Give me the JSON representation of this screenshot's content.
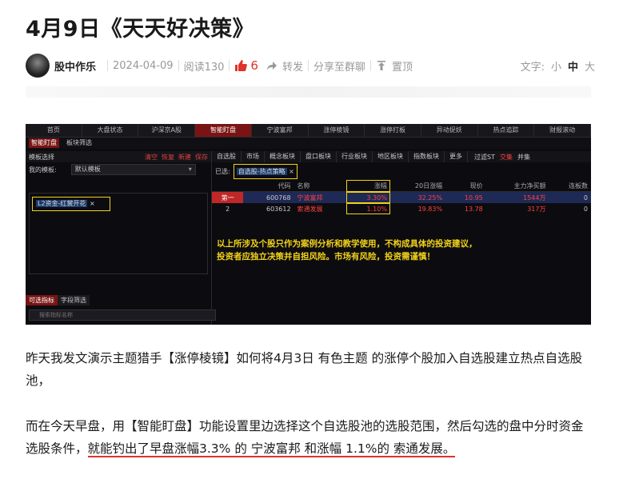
{
  "article": {
    "title": "4月9日《天天好决策》",
    "author": "股中作乐",
    "date": "2024-04-09",
    "reads": "阅读130",
    "likes": "6",
    "share_label": "转发",
    "share_group_label": "分享至群聊",
    "pin_label": "置顶",
    "font_label": "文字:",
    "font_sizes": [
      "小",
      "中",
      "大"
    ]
  },
  "screenshot": {
    "top_tabs": [
      "首页",
      "大盘状态",
      "沪深京A股",
      "智能盯盘",
      "宁波富邦",
      "涨停棱镜",
      "涨停打板",
      "异动捉妖",
      "热点追踪",
      "财报滚动"
    ],
    "active_tab": "智能盯盘",
    "sub_tabs": [
      "智能盯盘",
      "板块筛选"
    ],
    "left_header": "模板选择",
    "left_actions": [
      "清空",
      "恢复",
      "新建",
      "保存"
    ],
    "my_template_label": "我的模板:",
    "my_template_value": "默认模板",
    "template_tag": "L2资金-红裳开花",
    "bottom_tabs": [
      "可选指标",
      "字段筛选"
    ],
    "search_placeholder": "搜索指标名称",
    "filter_tabs": [
      "自选股",
      "市场",
      "概念板块",
      "盘口板块",
      "行业板块",
      "地区板块",
      "指数板块",
      "更多"
    ],
    "filter_st": "过滤ST",
    "radio_options": [
      "交集",
      "并集"
    ],
    "selected_label": "已选:",
    "selected_chip": "自选股-热点策略",
    "table_headers": [
      "代码",
      "名称",
      "涨幅",
      "20日涨幅",
      "现价",
      "主力净买额",
      "连板数"
    ],
    "rows": [
      {
        "rank": "第一",
        "code": "600768",
        "name": "宁波富邦",
        "chg": "3.30%",
        "chg20": "32.25%",
        "price": "10.95",
        "net": "1544万",
        "boards": "0"
      },
      {
        "rank": "2",
        "code": "603612",
        "name": "索通发展",
        "chg": "1.10%",
        "chg20": "19.83%",
        "price": "13.78",
        "net": "317万",
        "boards": "0"
      }
    ],
    "notice_line1": "以上所涉及个股只作为案例分析和教学使用，不构成具体的投资建议，",
    "notice_line2": "投资者应独立决策并自担风险。市场有风险，投资需谨慎！"
  },
  "body": {
    "p1": "昨天我发文演示主题猎手【涨停棱镜】如何将4月3日 有色主题 的涨停个股加入自选股建立热点自选股池，",
    "p2_part1": "而在今天早盘，用【智能盯盘】功能设置里边选择这个自选股池的选股范围，然后勾选的盘中分时资金选股条件，",
    "p2_part2": "就能钓出了早盘涨幅3.3% 的 宁波富邦 和涨幅 1.1%的 索通发展。"
  },
  "colors": {
    "accent_red": "#e0322c",
    "highlight_yellow": "#f2d21a",
    "dark_bg": "#0c0c10"
  }
}
